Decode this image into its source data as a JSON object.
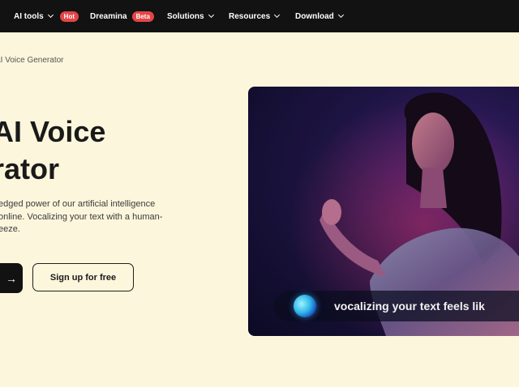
{
  "nav": {
    "items": [
      {
        "label": "AI tools",
        "badge": "Hot",
        "has_dropdown": true
      },
      {
        "label": "Dreamina",
        "badge": "Beta",
        "has_dropdown": false
      },
      {
        "label": "Solutions",
        "has_dropdown": true
      },
      {
        "label": "Resources",
        "has_dropdown": true
      },
      {
        "label": "Download",
        "has_dropdown": true
      }
    ]
  },
  "breadcrumb": "AI Voice Generator",
  "hero": {
    "title_line1": "AI Voice",
    "title_line2": "rator",
    "desc_line1": "edged power of our artificial intelligence",
    "desc_line2": "online. Vocalizing your text with a human-",
    "desc_line3": "eeze.",
    "cta_primary_icon": "arrow-right-icon",
    "cta_secondary": "Sign up for free"
  },
  "media": {
    "caption": "vocalizing your text feels lik"
  },
  "colors": {
    "nav_bg": "#121212",
    "page_bg": "#fcf6dc",
    "badge": "#e54545",
    "card_bg": "#1d1442"
  }
}
